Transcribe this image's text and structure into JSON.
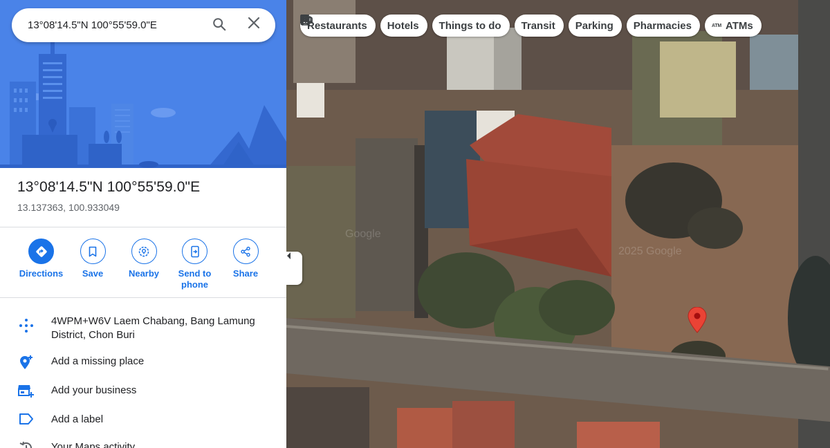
{
  "search": {
    "value": "13°08'14.5\"N 100°55'59.0\"E"
  },
  "place": {
    "title": "13°08'14.5\"N 100°55'59.0\"E",
    "coords": "13.137363, 100.933049"
  },
  "actions": [
    {
      "label": "Directions",
      "icon": "directions-icon"
    },
    {
      "label": "Save",
      "icon": "bookmark-icon"
    },
    {
      "label": "Nearby",
      "icon": "nearby-icon"
    },
    {
      "label": "Send to phone",
      "icon": "send-to-phone-icon"
    },
    {
      "label": "Share",
      "icon": "share-icon"
    }
  ],
  "info": [
    {
      "text": "4WPM+W6V Laem Chabang, Bang Lamung District, Chon Buri",
      "icon": "plus-code-icon"
    },
    {
      "text": "Add a missing place",
      "icon": "add-place-icon"
    },
    {
      "text": "Add your business",
      "icon": "add-business-icon"
    },
    {
      "text": "Add a label",
      "icon": "label-icon"
    },
    {
      "text": "Your Maps activity",
      "icon": "history-icon"
    }
  ],
  "chips": [
    {
      "label": "Restaurants",
      "icon": "restaurant-icon"
    },
    {
      "label": "Hotels",
      "icon": "hotel-icon"
    },
    {
      "label": "Things to do",
      "icon": "camera-icon"
    },
    {
      "label": "Transit",
      "icon": "transit-icon"
    },
    {
      "label": "Parking",
      "icon": "parking-icon"
    },
    {
      "label": "Pharmacies",
      "icon": "pharmacy-icon"
    },
    {
      "label": "ATMs",
      "icon": "atm-icon"
    }
  ],
  "map": {
    "watermarks": [
      "Google",
      "2025 Google"
    ]
  },
  "colors": {
    "accent": "#1a73e8",
    "pin": "#ea4335",
    "hero": "#4a83e8"
  }
}
